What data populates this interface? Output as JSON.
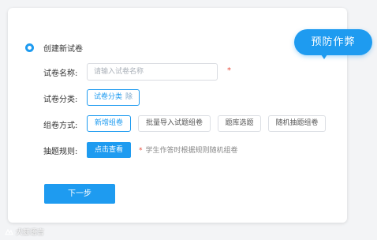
{
  "form": {
    "section_title": "创建新试卷",
    "paper_name_label": "试卷名称:",
    "paper_name_placeholder": "请输入试卷名称",
    "paper_name_value": "",
    "required_mark": "*",
    "category_label": "试卷分类:",
    "category_tag": "试卷分类",
    "category_remove": "除",
    "compose_label": "组卷方式:",
    "compose_options": [
      "新增组卷",
      "批量导入试题组卷",
      "题库选题",
      "随机抽题组卷"
    ],
    "compose_selected": "新增组卷",
    "rule_label": "抽题规则:",
    "rule_button": "点击查看",
    "rule_hint_star": "*",
    "rule_hint": "学生作答时根据规则随机组卷",
    "next_button": "下一步"
  },
  "bubble": {
    "text": "预防作弊"
  },
  "watermark": {
    "text": "犬兹语言"
  },
  "colors": {
    "accent": "#1e9bf0",
    "required": "#e74c3c",
    "background": "#f3f4f6"
  }
}
